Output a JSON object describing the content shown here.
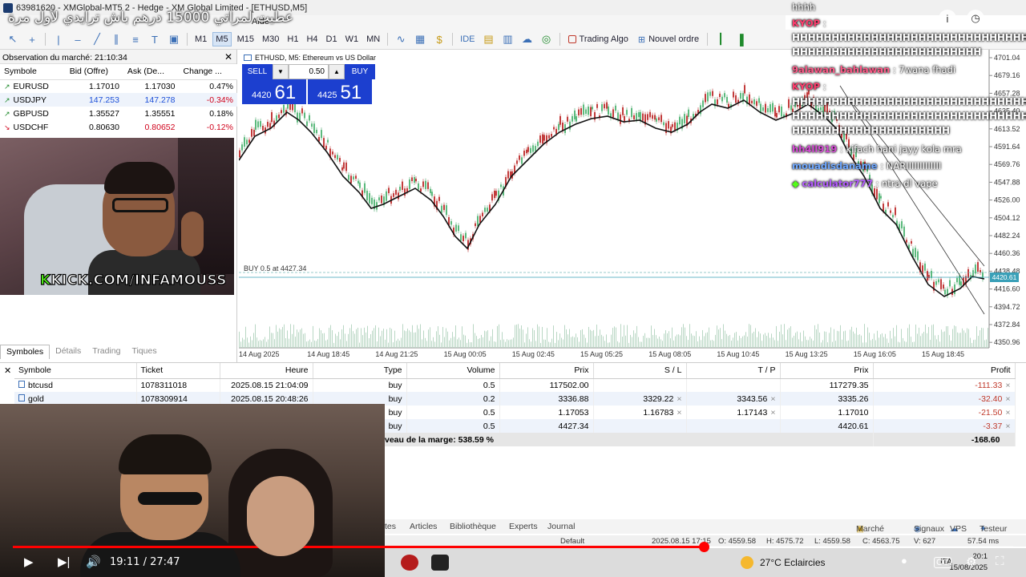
{
  "window": {
    "title": "63981620 - XMGlobal-MT5 2 - Hedge - XM Global Limited - [ETHUSD,M5]"
  },
  "overlay_title": "عطيت لمراتي 15000 درهم باش ترايدي لأول مرة",
  "menu": {
    "aide": "Aide"
  },
  "toolbar": {
    "timeframes": [
      "M1",
      "M5",
      "M15",
      "M30",
      "H1",
      "H4",
      "D1",
      "W1",
      "MN"
    ],
    "active_timeframe": "M5",
    "ide": "IDE",
    "trading_algo": "Trading Algo",
    "nouvel_ordre": "Nouvel ordre"
  },
  "market_watch": {
    "header": "Observation du marché: 21:10:34",
    "columns": [
      "Symbole",
      "Bid (Offre)",
      "Ask (De...",
      "Change ..."
    ],
    "rows": [
      {
        "symbol": "EURUSD",
        "bid": "1.17010",
        "ask": "1.17030",
        "change": "0.47%",
        "dir": "up"
      },
      {
        "symbol": "USDJPY",
        "bid": "147.253",
        "ask": "147.278",
        "change": "-0.34%",
        "dir": "up"
      },
      {
        "symbol": "GBPUSD",
        "bid": "1.35527",
        "ask": "1.35551",
        "change": "0.18%",
        "dir": "up"
      },
      {
        "symbol": "USDCHF",
        "bid": "0.80630",
        "ask": "0.80652",
        "change": "-0.12%",
        "dir": "down"
      }
    ],
    "tabs": [
      "Symboles",
      "Détails",
      "Trading",
      "Tiques"
    ],
    "active_tab": "Symboles"
  },
  "kick_banner": {
    "k": "K",
    "text": "KICK.COM/INFAMOUSS"
  },
  "chart": {
    "title": "ETHUSD, M5:  Ethereum vs US Dollar",
    "trade_panel": {
      "sell": "SELL",
      "buy": "BUY",
      "volume": "0.50",
      "sell_small": "4420",
      "sell_big": "61",
      "buy_small": "4425",
      "buy_big": "51"
    },
    "buy_line_label": "BUY 0.5 at 4427.34",
    "current_price": "4420.61",
    "price_labels": [
      "4701.04",
      "4679.16",
      "4657.28",
      "4635.40",
      "4613.52",
      "4591.64",
      "4569.76",
      "4547.88",
      "4526.00",
      "4504.12",
      "4482.24",
      "4460.36",
      "4438.48",
      "4416.60",
      "4394.72",
      "4372.84",
      "4350.96"
    ],
    "time_labels": [
      "14 Aug 2025",
      "14 Aug 18:45",
      "14 Aug 21:25",
      "15 Aug 00:05",
      "15 Aug 02:45",
      "15 Aug 05:25",
      "15 Aug 08:05",
      "15 Aug 10:45",
      "15 Aug 13:25",
      "15 Aug 16:05",
      "15 Aug 18:45"
    ]
  },
  "chat": {
    "top": "hhhh",
    "messages": [
      {
        "user": "KYOP",
        "text": ":"
      },
      {
        "user": "",
        "text": "HHHHHHHHHHHHHHHHHHHHHHHHHHHHHHHH"
      },
      {
        "user": "",
        "text": "HHHHHHHHHHHHHHHHHHHHHHHH"
      },
      {
        "user": "9alawan_bahlawan",
        "text": ": 7wana fhadi"
      },
      {
        "user": "KYOP",
        "text": ":"
      },
      {
        "user": "",
        "text": "HHHHHHHHHHHHHHHHHHHHHHHHHHHHHHHH"
      },
      {
        "user": "",
        "text": "HHHHHHHHHHHHHHHHHHHHHHHHHHHHHHHH"
      },
      {
        "user": "",
        "text": "HHHHHHHHHHHHHHHHHHHH"
      },
      {
        "user": "hh4ll919",
        "text": ": kifach hani jayy kola mra"
      },
      {
        "user": "mouadisdaname",
        "text": ": NARIIIIIIIIIIIII"
      },
      {
        "user": "calculator777",
        "text": ": ntra dl vape"
      }
    ]
  },
  "positions": {
    "columns": [
      "Symbole",
      "Ticket",
      "Heure",
      "Type",
      "Volume",
      "Prix",
      "S / L",
      "T / P",
      "Prix",
      "Profit"
    ],
    "rows": [
      {
        "symbol": "btcusd",
        "ticket": "1078311018",
        "time": "2025.08.15 21:04:09",
        "type": "buy",
        "volume": "0.5",
        "price": "117502.00",
        "sl": "",
        "tp": "",
        "current": "117279.35",
        "profit": "-111.33"
      },
      {
        "symbol": "gold",
        "ticket": "1078309914",
        "time": "2025.08.15 20:48:26",
        "type": "buy",
        "volume": "0.2",
        "price": "3336.88",
        "sl": "3329.22",
        "tp": "3343.56",
        "current": "3335.26",
        "profit": "-32.40"
      },
      {
        "symbol": "",
        "ticket": "",
        "time": "",
        "type": "buy",
        "volume": "0.5",
        "price": "1.17053",
        "sl": "1.16783",
        "tp": "1.17143",
        "current": "1.17010",
        "profit": "-21.50"
      },
      {
        "symbol": "",
        "ticket": "",
        "time": "",
        "type": "buy",
        "volume": "0.5",
        "price": "4427.34",
        "sl": "",
        "tp": "",
        "current": "4420.61",
        "profit": "-3.37"
      }
    ],
    "summary_label": "veau de la marge: 538.59 %",
    "summary_profit": "-168.60"
  },
  "bottom_tabs": [
    "tes",
    "Articles",
    "Bibliothèque",
    "Experts",
    "Journal"
  ],
  "bottom_right_tabs": [
    "Marché",
    "Signaux",
    "VPS",
    "Testeur"
  ],
  "status": {
    "default": "Default",
    "date": "2025.08.15 17:15",
    "open": "O: 4559.58",
    "high": "H: 4575.72",
    "low": "L: 4559.58",
    "close": "C: 4563.75",
    "vol": "V: 627",
    "ping": "57.54 ms"
  },
  "video": {
    "time": "19:11 / 27:47",
    "progress": 0.6906
  },
  "taskbar": {
    "weather": "27°C  Eclaircies",
    "lang": "ITA",
    "clock_time": "20:1",
    "clock_date": "15/08/2025"
  }
}
